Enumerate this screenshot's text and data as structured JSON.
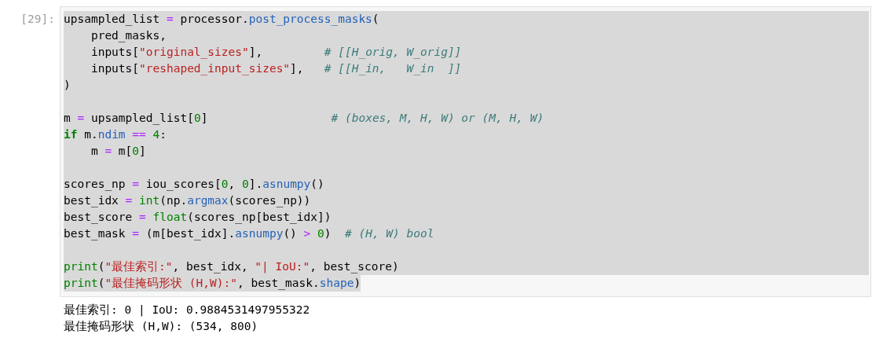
{
  "cell": {
    "prompt": "[29]:",
    "selected": true,
    "lines": [
      {
        "kind": "code",
        "tokens": [
          {
            "kind": "plain",
            "text": "upsampled_list "
          },
          {
            "kind": "op",
            "text": "="
          },
          {
            "kind": "plain",
            "text": " processor."
          },
          {
            "kind": "attr",
            "text": "post_process_masks"
          },
          {
            "kind": "plain",
            "text": "("
          }
        ]
      },
      {
        "kind": "code",
        "tokens": [
          {
            "kind": "plain",
            "text": "    pred_masks,"
          }
        ]
      },
      {
        "kind": "code",
        "tokens": [
          {
            "kind": "plain",
            "text": "    inputs["
          },
          {
            "kind": "str",
            "text": "\"original_sizes\""
          },
          {
            "kind": "plain",
            "text": "],         "
          },
          {
            "kind": "comment",
            "text": "# [[H_orig, W_orig]]"
          }
        ]
      },
      {
        "kind": "code",
        "tokens": [
          {
            "kind": "plain",
            "text": "    inputs["
          },
          {
            "kind": "str",
            "text": "\"reshaped_input_sizes\""
          },
          {
            "kind": "plain",
            "text": "],   "
          },
          {
            "kind": "comment",
            "text": "# [[H_in,   W_in  ]]"
          }
        ]
      },
      {
        "kind": "code",
        "tokens": [
          {
            "kind": "plain",
            "text": ")"
          }
        ]
      },
      {
        "kind": "blank"
      },
      {
        "kind": "code",
        "tokens": [
          {
            "kind": "plain",
            "text": "m "
          },
          {
            "kind": "op",
            "text": "="
          },
          {
            "kind": "plain",
            "text": " upsampled_list["
          },
          {
            "kind": "num",
            "text": "0"
          },
          {
            "kind": "plain",
            "text": "]                  "
          },
          {
            "kind": "comment",
            "text": "# (boxes, M, H, W) or (M, H, W)"
          }
        ]
      },
      {
        "kind": "code",
        "tokens": [
          {
            "kind": "kw",
            "text": "if"
          },
          {
            "kind": "plain",
            "text": " m."
          },
          {
            "kind": "attr",
            "text": "ndim"
          },
          {
            "kind": "op",
            "text": " == "
          },
          {
            "kind": "num",
            "text": "4"
          },
          {
            "kind": "plain",
            "text": ":"
          }
        ]
      },
      {
        "kind": "code",
        "tokens": [
          {
            "kind": "plain",
            "text": "    m "
          },
          {
            "kind": "op",
            "text": "="
          },
          {
            "kind": "plain",
            "text": " m["
          },
          {
            "kind": "num",
            "text": "0"
          },
          {
            "kind": "plain",
            "text": "]"
          }
        ]
      },
      {
        "kind": "blank"
      },
      {
        "kind": "code",
        "tokens": [
          {
            "kind": "plain",
            "text": "scores_np "
          },
          {
            "kind": "op",
            "text": "="
          },
          {
            "kind": "plain",
            "text": " iou_scores["
          },
          {
            "kind": "num",
            "text": "0"
          },
          {
            "kind": "plain",
            "text": ", "
          },
          {
            "kind": "num",
            "text": "0"
          },
          {
            "kind": "plain",
            "text": "]."
          },
          {
            "kind": "attr",
            "text": "asnumpy"
          },
          {
            "kind": "plain",
            "text": "()"
          }
        ]
      },
      {
        "kind": "code",
        "tokens": [
          {
            "kind": "plain",
            "text": "best_idx "
          },
          {
            "kind": "op",
            "text": "= "
          },
          {
            "kind": "builtin",
            "text": "int"
          },
          {
            "kind": "plain",
            "text": "(np."
          },
          {
            "kind": "attr",
            "text": "argmax"
          },
          {
            "kind": "plain",
            "text": "(scores_np))"
          }
        ]
      },
      {
        "kind": "code",
        "tokens": [
          {
            "kind": "plain",
            "text": "best_score "
          },
          {
            "kind": "op",
            "text": "= "
          },
          {
            "kind": "builtin",
            "text": "float"
          },
          {
            "kind": "plain",
            "text": "(scores_np[best_idx])"
          }
        ]
      },
      {
        "kind": "code",
        "tokens": [
          {
            "kind": "plain",
            "text": "best_mask "
          },
          {
            "kind": "op",
            "text": "="
          },
          {
            "kind": "plain",
            "text": " (m[best_idx]."
          },
          {
            "kind": "attr",
            "text": "asnumpy"
          },
          {
            "kind": "plain",
            "text": "() "
          },
          {
            "kind": "op",
            "text": "> "
          },
          {
            "kind": "num",
            "text": "0"
          },
          {
            "kind": "plain",
            "text": ")  "
          },
          {
            "kind": "comment",
            "text": "# (H, W) bool"
          }
        ]
      },
      {
        "kind": "blank"
      },
      {
        "kind": "code",
        "tokens": [
          {
            "kind": "builtin",
            "text": "print"
          },
          {
            "kind": "plain",
            "text": "("
          },
          {
            "kind": "str",
            "text": "\"最佳索引:\""
          },
          {
            "kind": "plain",
            "text": ", best_idx, "
          },
          {
            "kind": "str",
            "text": "\"| IoU:\""
          },
          {
            "kind": "plain",
            "text": ", best_score)"
          }
        ]
      },
      {
        "kind": "code",
        "tokens": [
          {
            "kind": "builtin",
            "text": "print"
          },
          {
            "kind": "plain",
            "text": "("
          },
          {
            "kind": "str",
            "text": "\"最佳掩码形状 (H,W):\""
          },
          {
            "kind": "plain",
            "text": ", best_mask."
          },
          {
            "kind": "attr",
            "text": "shape"
          },
          {
            "kind": "plain",
            "text": ")"
          }
        ]
      }
    ],
    "output": [
      "最佳索引: 0 | IoU: 0.9884531497955322",
      "最佳掩码形状 (H,W): (534, 800)"
    ]
  }
}
